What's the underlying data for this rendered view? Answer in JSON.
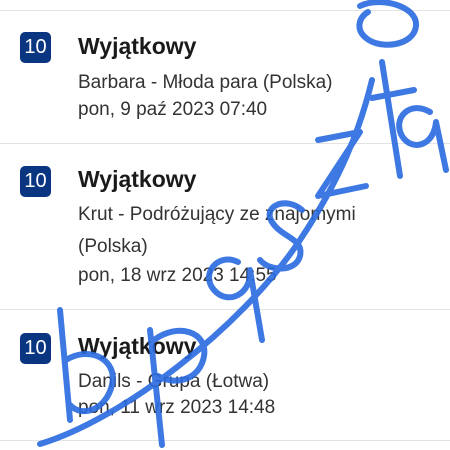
{
  "colors": {
    "badge": "#0a3580",
    "badge_text": "#ffffff",
    "text": "#1a1a1a",
    "watermark": "#2a6be0"
  },
  "reviews": [
    {
      "score": "10",
      "title": "Wyjątkowy",
      "reviewer": "Barbara - Młoda para (Polska)",
      "date": "pon, 9 paź 2023 07:40"
    },
    {
      "score": "10",
      "title": "Wyjątkowy",
      "reviewer": "Krut - Podróżujący ze znajomymi (Polska)",
      "date": "pon, 18 wrz 2023 14:55"
    },
    {
      "score": "10",
      "title": "Wyjątkowy",
      "reviewer": "Danils - Grupa (Łotwa)",
      "date": "pon, 11 wrz 2023 14:48"
    }
  ],
  "watermark_text": "bp9sztany"
}
